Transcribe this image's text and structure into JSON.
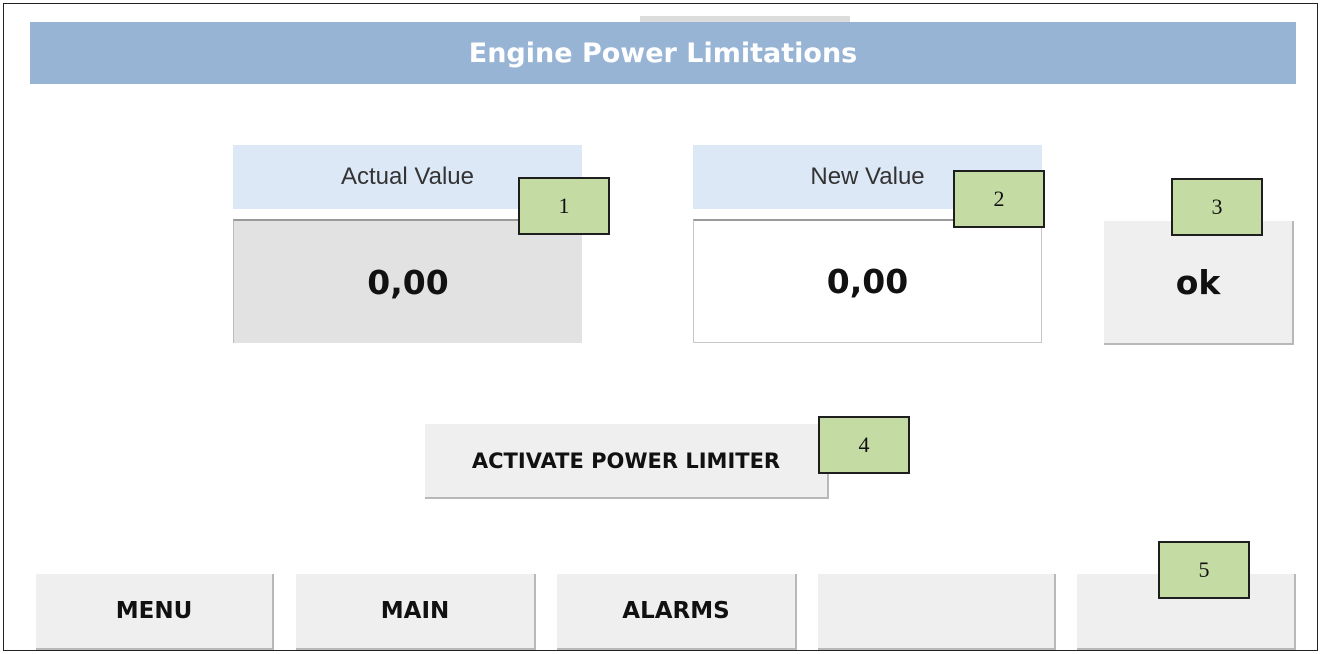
{
  "window": {
    "title": "Engine Power Limitations"
  },
  "values": {
    "actual_label": "Actual Value",
    "actual_value": "0,00",
    "new_label": "New Value",
    "new_value": "0,00",
    "ok_label": "ok"
  },
  "activate_label": "ACTIVATE POWER LIMITER",
  "nav": {
    "menu": "MENU",
    "main": "MAIN",
    "alarms": "ALARMS",
    "slot4": "",
    "slot5": ""
  },
  "callouts": [
    "1",
    "2",
    "3",
    "4",
    "5"
  ],
  "colors": {
    "title_bar": "#98b4d4",
    "header": "#dce8f5",
    "callout": "#c5dba4",
    "button": "#efefef"
  }
}
